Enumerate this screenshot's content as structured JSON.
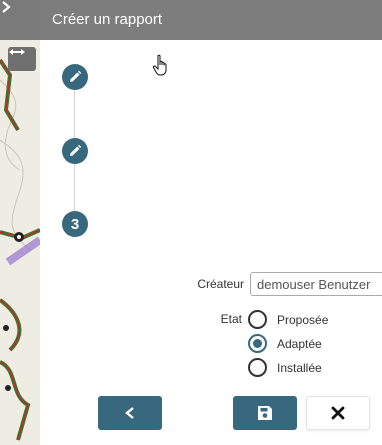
{
  "panel": {
    "title": "Créer un rapport"
  },
  "stepper": {
    "steps": [
      {
        "state": "edit",
        "icon": "pencil-icon"
      },
      {
        "state": "edit",
        "icon": "pencil-icon"
      },
      {
        "state": "current",
        "number": "3"
      }
    ]
  },
  "form": {
    "creator_label": "Créateur",
    "creator_value": "demouser Benutzer",
    "state_label": "Etat",
    "state_options": [
      {
        "label": "Proposée",
        "checked": false
      },
      {
        "label": "Adaptée",
        "checked": true
      },
      {
        "label": "Installée",
        "checked": false
      }
    ]
  },
  "buttons": {
    "back_icon": "chevron-left-icon",
    "save_icon": "save-icon",
    "cancel_icon": "close-icon"
  },
  "colors": {
    "accent": "#38687e",
    "header": "#7d7d7d"
  }
}
